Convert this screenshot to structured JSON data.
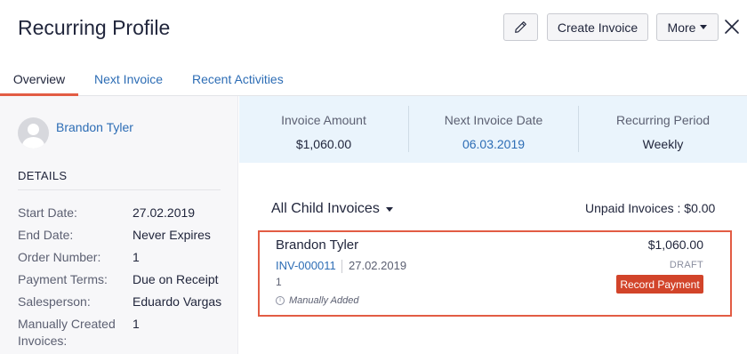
{
  "header": {
    "title": "Recurring Profile",
    "edit_icon": "pencil-icon",
    "create_invoice_label": "Create Invoice",
    "more_label": "More",
    "close_icon": "close-icon"
  },
  "tabs": [
    {
      "label": "Overview",
      "active": true
    },
    {
      "label": "Next Invoice",
      "active": false
    },
    {
      "label": "Recent Activities",
      "active": false
    }
  ],
  "sidebar": {
    "customer_name": "Brandon Tyler",
    "details_heading": "DETAILS",
    "details": [
      {
        "label": "Start Date:",
        "value": "27.02.2019"
      },
      {
        "label": "End Date:",
        "value": "Never Expires"
      },
      {
        "label": "Order Number:",
        "value": "1"
      },
      {
        "label": "Payment Terms:",
        "value": "Due on Receipt"
      },
      {
        "label": "Salesperson:",
        "value": "Eduardo Vargas"
      },
      {
        "label": "Manually Created Invoices:",
        "value": "1"
      }
    ]
  },
  "summary": {
    "invoice_amount_label": "Invoice Amount",
    "invoice_amount_value": "$1,060.00",
    "next_invoice_date_label": "Next Invoice Date",
    "next_invoice_date_value": "06.03.2019",
    "recurring_period_label": "Recurring Period",
    "recurring_period_value": "Weekly"
  },
  "child_invoices": {
    "filter_label": "All Child Invoices",
    "unpaid_label": "Unpaid Invoices :",
    "unpaid_value": "$0.00",
    "items": [
      {
        "customer": "Brandon Tyler",
        "amount": "$1,060.00",
        "invoice_number": "INV-000011",
        "date": "27.02.2019",
        "status": "DRAFT",
        "quantity": "1",
        "note": "Manually Added",
        "action_label": "Record Payment"
      }
    ]
  },
  "colors": {
    "accent": "#e25c44",
    "link": "#2d6db5",
    "record_payment": "#d2442a",
    "summary_bg": "#eaf4fc"
  }
}
